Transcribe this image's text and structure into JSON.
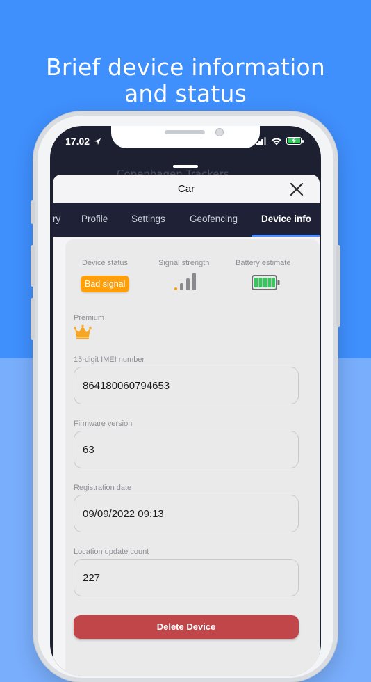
{
  "headline": {
    "line1": "Brief device information",
    "line2": "and status"
  },
  "status_bar": {
    "time": "17.02",
    "location_icon": "location-arrow-icon",
    "signal_icon": "cellular-signal-icon",
    "wifi_icon": "wifi-icon",
    "battery_icon": "battery-charging-icon"
  },
  "background_header": {
    "title": "Copenhagen Trackers"
  },
  "sheet": {
    "title": "Car",
    "close_icon": "close-icon"
  },
  "tabs": [
    {
      "label": "ry"
    },
    {
      "label": "Profile"
    },
    {
      "label": "Settings"
    },
    {
      "label": "Geofencing"
    },
    {
      "label": "Device info",
      "active": true
    }
  ],
  "device_info": {
    "status_label": "Device status",
    "status_value": "Bad signal",
    "signal_label": "Signal strength",
    "battery_label": "Battery estimate",
    "premium_label": "Premium",
    "premium_icon": "crown-icon",
    "imei_label": "15-digit IMEI number",
    "imei_value": "864180060794653",
    "firmware_label": "Firmware version",
    "firmware_value": "63",
    "registration_label": "Registration date",
    "registration_value": "09/09/2022 09:13",
    "location_count_label": "Location update count",
    "location_count_value": "227",
    "delete_label": "Delete Device"
  },
  "colors": {
    "bg_top": "#3f8ffd",
    "bg_bottom": "#79aefc",
    "tab_bar": "#1f2236",
    "badge": "#ff9f0a",
    "delete": "#c0464a",
    "accent": "#4c8dff",
    "battery_green": "#34c759",
    "crown": "#f5a623"
  }
}
